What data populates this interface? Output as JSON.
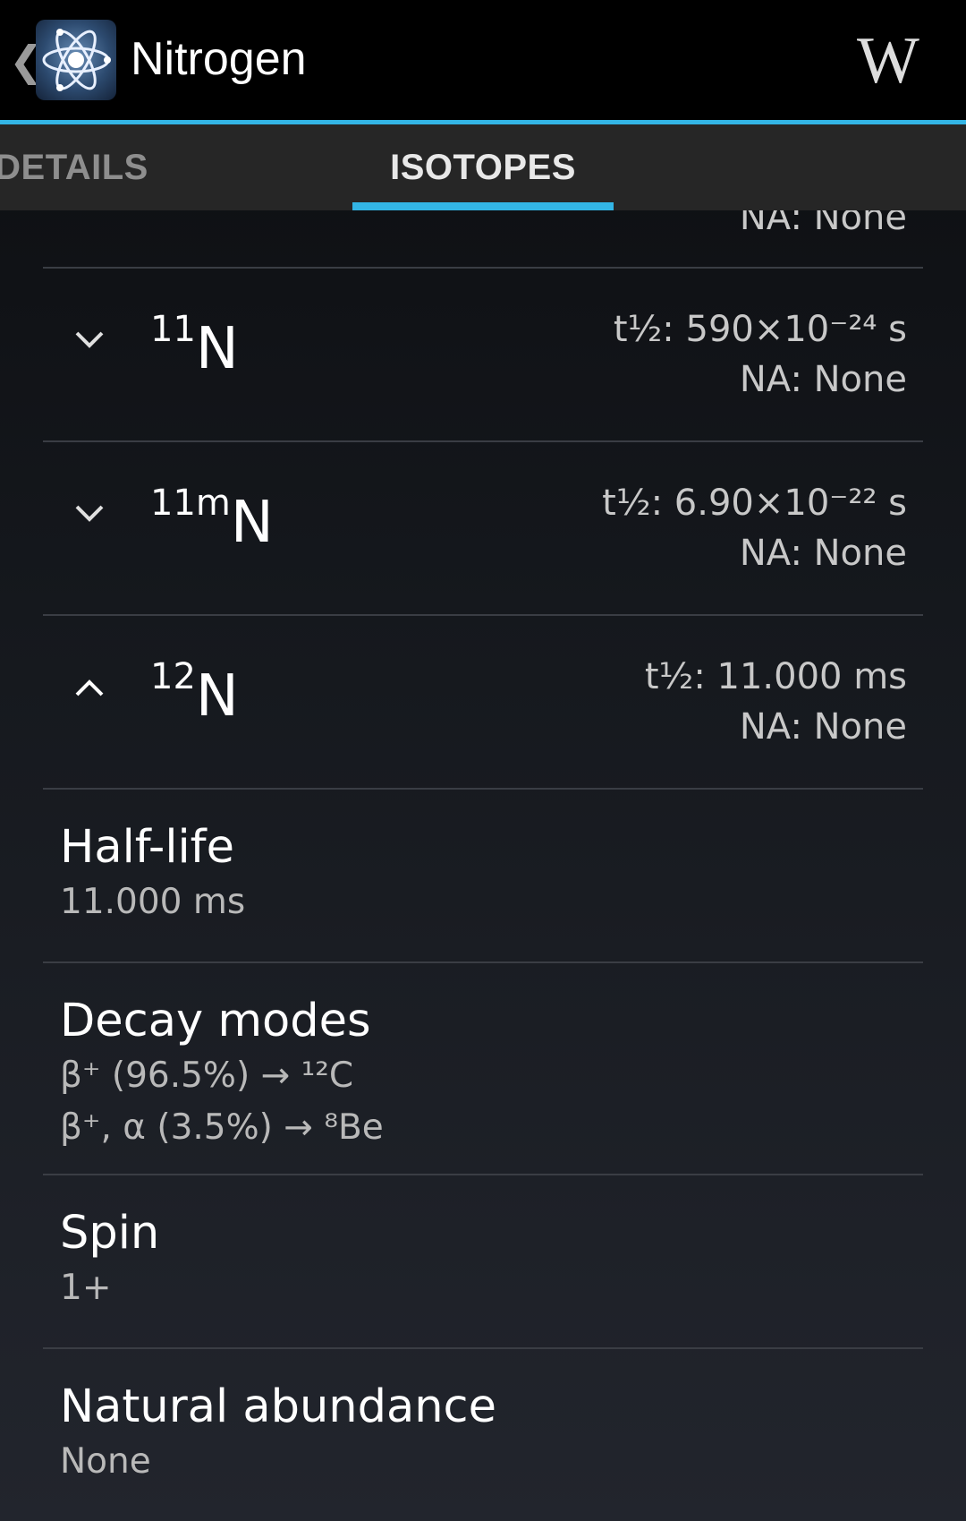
{
  "app_bar": {
    "title": "Nitrogen",
    "back_icon": "chevron-left-icon",
    "app_icon": "atom-icon",
    "wiki_label": "W",
    "accent_color": "#33b5e5"
  },
  "tabs": [
    {
      "label": "DETAILS",
      "selected": false
    },
    {
      "label": "ISOTOPES",
      "selected": true
    }
  ],
  "partial_row": {
    "na": "NA: None"
  },
  "isotopes": [
    {
      "mass": "11",
      "suffix": "",
      "symbol": "N",
      "half_life": "t½: 590×10⁻²⁴ s",
      "na": "NA: None",
      "expanded": false
    },
    {
      "mass": "11",
      "suffix": "m",
      "symbol": "N",
      "half_life": "t½: 6.90×10⁻²² s",
      "na": "NA: None",
      "expanded": false
    },
    {
      "mass": "12",
      "suffix": "",
      "symbol": "N",
      "half_life": "t½: 11.000 ms",
      "na": "NA: None",
      "expanded": true
    }
  ],
  "details": {
    "half_life": {
      "label": "Half-life",
      "value": "11.000 ms"
    },
    "decay_modes": {
      "label": "Decay modes",
      "values": [
        "β⁺ (96.5%) → ¹²C",
        "β⁺, α (3.5%) → ⁸Be"
      ]
    },
    "spin": {
      "label": "Spin",
      "value": "1+"
    },
    "natural_abundance": {
      "label": "Natural abundance",
      "value": "None"
    }
  }
}
